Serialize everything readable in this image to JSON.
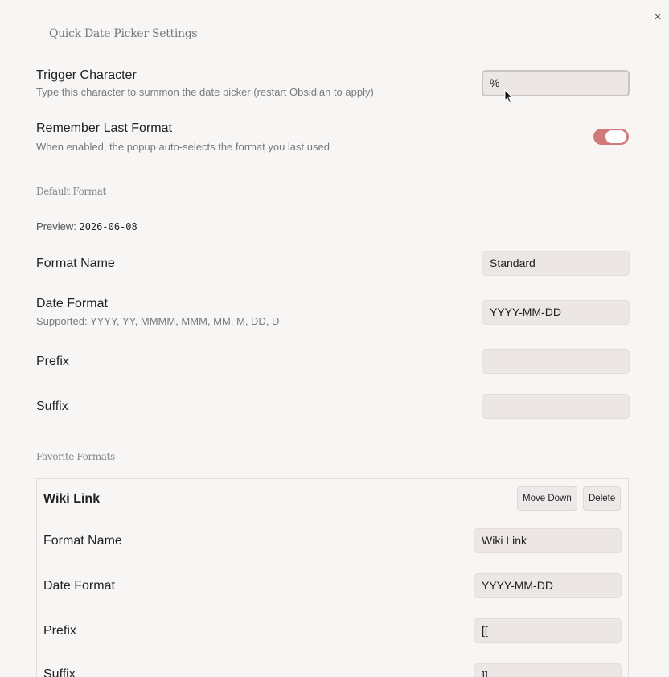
{
  "modal": {
    "title": "Quick Date Picker Settings",
    "close_icon": "×"
  },
  "settings": {
    "trigger": {
      "name": "Trigger Character",
      "desc": "Type this character to summon the date picker (restart Obsidian to apply)",
      "value": "%"
    },
    "remember": {
      "name": "Remember Last Format",
      "desc": "When enabled, the popup auto-selects the format you last used",
      "enabled": true
    }
  },
  "default_format": {
    "heading": "Default Format",
    "preview_label": "Preview:",
    "preview_value": "2026-06-08",
    "format_name": {
      "name": "Format Name",
      "value": "Standard"
    },
    "date_format": {
      "name": "Date Format",
      "desc": "Supported: YYYY, YY, MMMM, MMM, MM, M, DD, D",
      "value": "YYYY-MM-DD"
    },
    "prefix": {
      "name": "Prefix",
      "value": ""
    },
    "suffix": {
      "name": "Suffix",
      "value": ""
    }
  },
  "favorites": {
    "heading": "Favorite Formats",
    "items": [
      {
        "title": "Wiki Link",
        "move_down_label": "Move Down",
        "delete_label": "Delete",
        "format_name": {
          "name": "Format Name",
          "value": "Wiki Link"
        },
        "date_format": {
          "name": "Date Format",
          "value": "YYYY-MM-DD"
        },
        "prefix": {
          "name": "Prefix",
          "value": "[["
        },
        "suffix": {
          "name": "Suffix",
          "value": "]]"
        }
      }
    ]
  },
  "colors": {
    "accent": "#d17a7a",
    "background": "#f8f6f5",
    "input_bg": "#ece6e5"
  }
}
